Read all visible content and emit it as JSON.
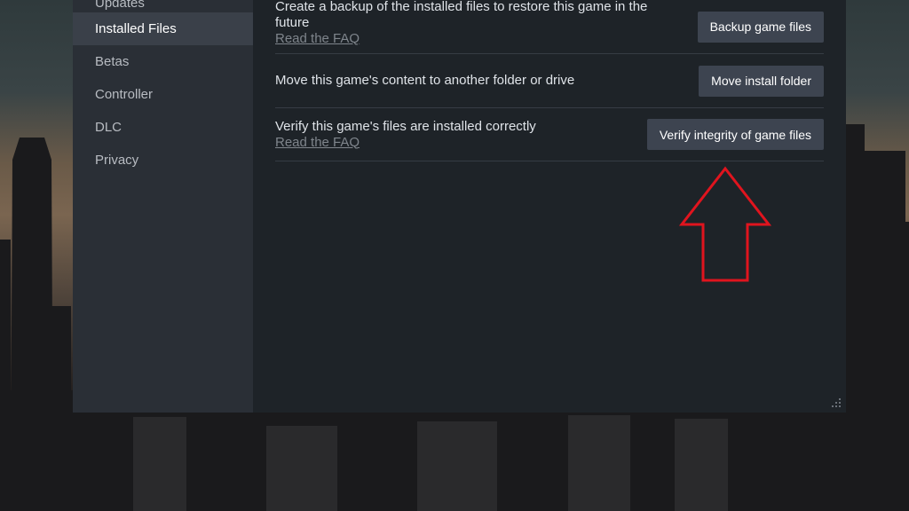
{
  "sidebar": {
    "items": [
      {
        "label": "Updates"
      },
      {
        "label": "Installed Files",
        "active": true
      },
      {
        "label": "Betas"
      },
      {
        "label": "Controller"
      },
      {
        "label": "DLC"
      },
      {
        "label": "Privacy"
      }
    ]
  },
  "main": {
    "rows": [
      {
        "text": "Create a backup of the installed files to restore this game in the future",
        "link": "Read the FAQ",
        "button": "Backup game files"
      },
      {
        "text": "Move this game's content to another folder or drive",
        "button": "Move install folder"
      },
      {
        "text": "Verify this game's files are installed correctly",
        "link": "Read the FAQ",
        "button": "Verify integrity of game files"
      }
    ]
  },
  "colors": {
    "window_bg": "#1e2328",
    "sidebar_bg": "#2a2f36",
    "sidebar_active_bg": "#3a4049",
    "button_bg": "#3d4450",
    "annotation_arrow": "#e0141e"
  },
  "icons": {
    "annotation": "up-arrow-outline-icon",
    "resize": "resize-grip-icon"
  }
}
